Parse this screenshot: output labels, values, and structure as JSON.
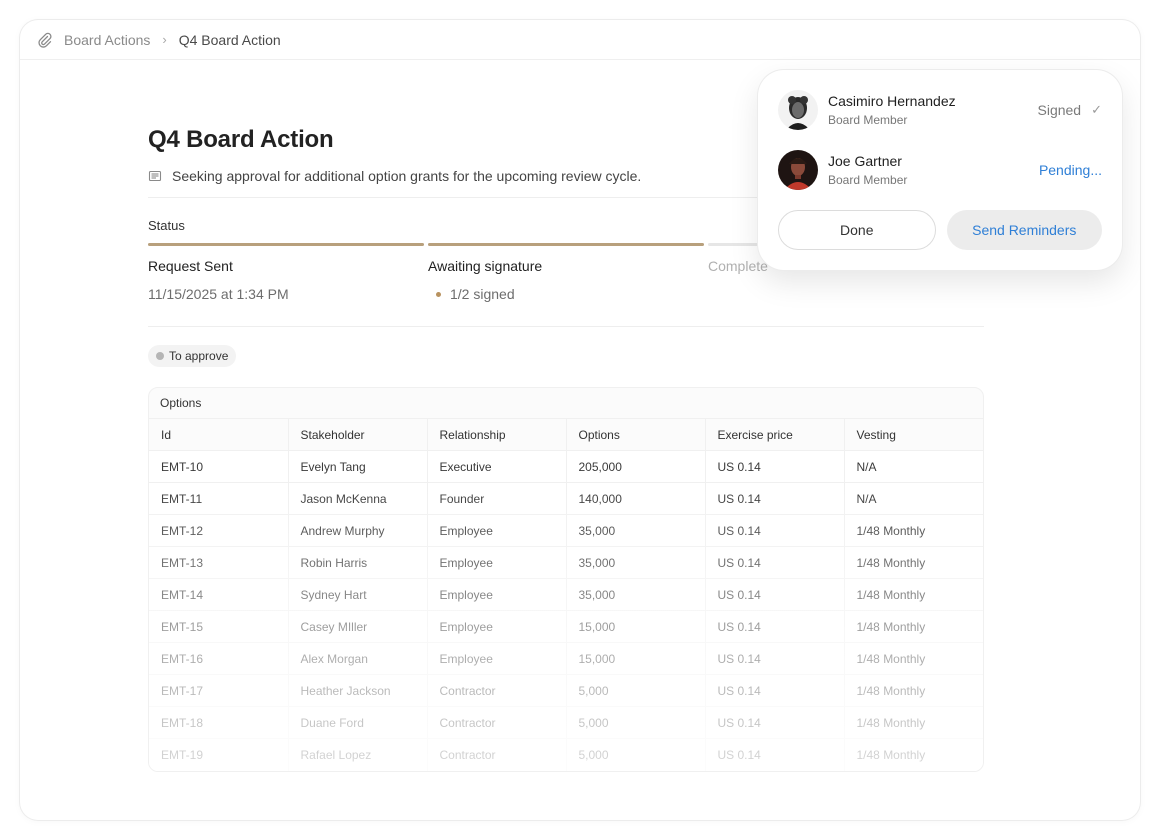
{
  "breadcrumb": {
    "icon": "paperclip-icon",
    "parent": "Board Actions",
    "separator": "›",
    "current": "Q4 Board Action"
  },
  "page": {
    "title": "Q4 Board Action",
    "description_icon": "document-icon",
    "description": "Seeking approval for additional option grants for the upcoming review cycle."
  },
  "status": {
    "label": "Status",
    "steps": [
      {
        "title": "Request Sent",
        "subtitle": "11/15/2025 at 1:34 PM",
        "active": true
      },
      {
        "title": "Awaiting signature",
        "subtitle": "1/2 signed",
        "active": true
      },
      {
        "title": "Complete",
        "subtitle": "",
        "active": false
      }
    ],
    "accent_color": "#b8a07c"
  },
  "tag": {
    "label": "To approve"
  },
  "options_table": {
    "title": "Options",
    "columns": [
      "Id",
      "Stakeholder",
      "Relationship",
      "Options",
      "Exercise price",
      "Vesting"
    ],
    "rows": [
      [
        "EMT-10",
        "Evelyn Tang",
        "Executive",
        "205,000",
        "US 0.14",
        "N/A"
      ],
      [
        "EMT-11",
        "Jason McKenna",
        "Founder",
        "140,000",
        "US 0.14",
        "N/A"
      ],
      [
        "EMT-12",
        "Andrew Murphy",
        "Employee",
        "35,000",
        "US 0.14",
        "1/48 Monthly"
      ],
      [
        "EMT-13",
        "Robin Harris",
        "Employee",
        "35,000",
        "US 0.14",
        "1/48 Monthly"
      ],
      [
        "EMT-14",
        "Sydney Hart",
        "Employee",
        "35,000",
        "US 0.14",
        "1/48 Monthly"
      ],
      [
        "EMT-15",
        "Casey MIller",
        "Employee",
        "15,000",
        "US 0.14",
        "1/48 Monthly"
      ],
      [
        "EMT-16",
        "Alex Morgan",
        "Employee",
        "15,000",
        "US 0.14",
        "1/48 Monthly"
      ],
      [
        "EMT-17",
        "Heather Jackson",
        "Contractor",
        "5,000",
        "US 0.14",
        "1/48 Monthly"
      ],
      [
        "EMT-18",
        "Duane Ford",
        "Contractor",
        "5,000",
        "US 0.14",
        "1/48 Monthly"
      ],
      [
        "EMT-19",
        "Rafael Lopez",
        "Contractor",
        "5,000",
        "US 0.14",
        "1/48 Monthly"
      ]
    ]
  },
  "signers_popover": {
    "signers": [
      {
        "name": "Casimiro Hernandez",
        "role": "Board Member",
        "status": "Signed",
        "status_icon": "check-icon"
      },
      {
        "name": "Joe Gartner",
        "role": "Board Member",
        "status": "Pending..."
      }
    ],
    "done_label": "Done",
    "remind_label": "Send Reminders",
    "link_color": "#2f7fd6"
  }
}
